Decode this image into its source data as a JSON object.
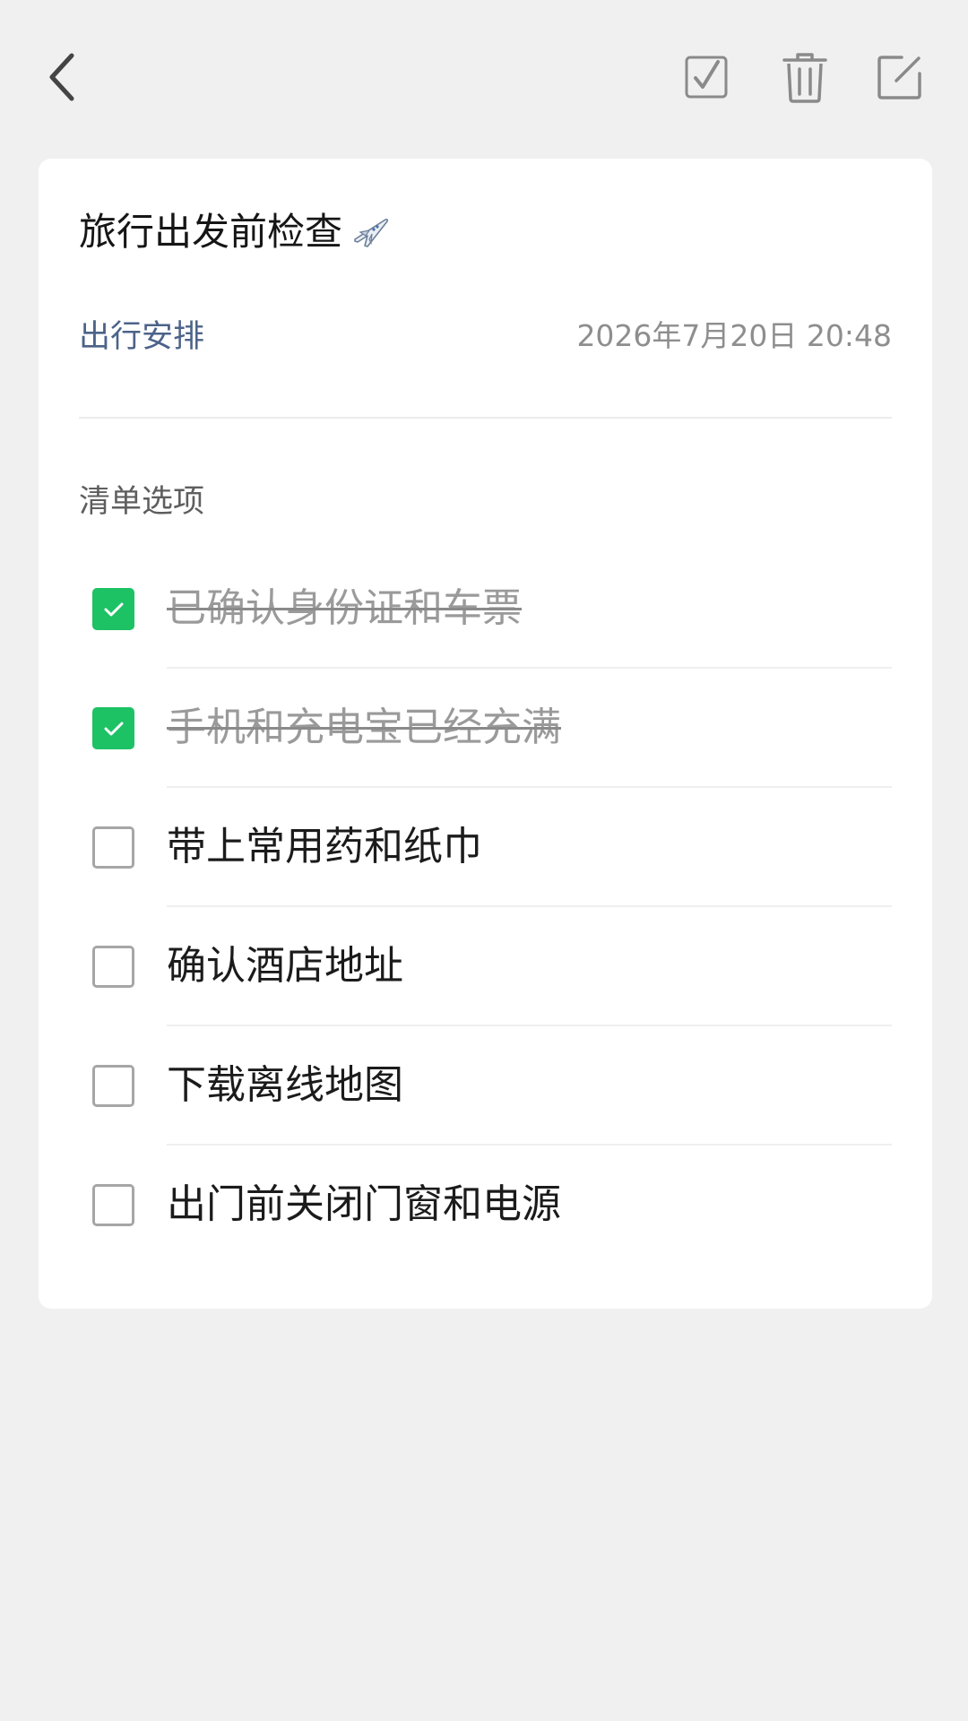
{
  "toolbar": {
    "back_icon": "back-arrow-icon",
    "check_icon": "checkbox-icon",
    "delete_icon": "trash-icon",
    "edit_icon": "edit-icon"
  },
  "note": {
    "title": "旅行出发前检查",
    "title_emoji": "airplane-icon",
    "category": "出行安排",
    "timestamp": "2026年7月20日 20:48",
    "section_label": "清单选项",
    "items": [
      {
        "text": "已确认身份证和车票",
        "checked": true
      },
      {
        "text": "手机和充电宝已经充满",
        "checked": true
      },
      {
        "text": "带上常用药和纸巾",
        "checked": false
      },
      {
        "text": "确认酒店地址",
        "checked": false
      },
      {
        "text": "下载离线地图",
        "checked": false
      },
      {
        "text": "出门前关闭门窗和电源",
        "checked": false
      }
    ]
  },
  "colors": {
    "background": "#f0f0f0",
    "card": "#ffffff",
    "checked": "#1dc264",
    "category": "#4c6389",
    "muted": "#8e8e8e"
  }
}
